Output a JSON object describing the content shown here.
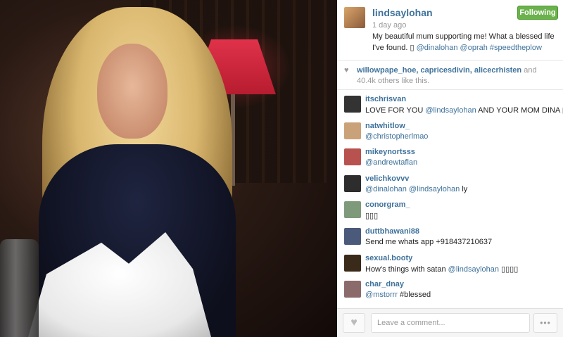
{
  "post": {
    "username": "lindsaylohan",
    "time": "1 day ago",
    "follow_label": "Following",
    "caption_text": "My beautiful mum supporting me! What a blessed life I've found. ",
    "caption_emoji": "▯",
    "caption_mentions": "@dinalohan @oprah",
    "caption_tag": "#speedtheplow"
  },
  "likes": {
    "icon": "heart-icon",
    "users": "willowpape_hoe, capricesdivin, alicecrhisten",
    "count_text": " and 40.4k others like this."
  },
  "comments": [
    {
      "user": "itschrisvan",
      "pre": "LOVE FOR YOU ",
      "mention": "@lindsaylohan",
      "post": " AND YOUR MOM DINA ▯▯▯▯",
      "avatar_color": "#333333"
    },
    {
      "user": "natwhitlow_",
      "pre": "",
      "mention": "@christopherlmao",
      "post": "",
      "avatar_color": "#c9a27a"
    },
    {
      "user": "mikeynortsss",
      "pre": "",
      "mention": "@andrewtaflan",
      "post": "",
      "avatar_color": "#b7524f"
    },
    {
      "user": "velichkovvv",
      "pre": "",
      "mention": "@dinalohan @lindsaylohan",
      "post": " ly",
      "avatar_color": "#2d2d2d"
    },
    {
      "user": "conorgram_",
      "pre": "▯▯▯",
      "mention": "",
      "post": "",
      "avatar_color": "#7f9a7a"
    },
    {
      "user": "duttbhawani88",
      "pre": "Send me whats app +918437210637",
      "mention": "",
      "post": "",
      "avatar_color": "#4b5a7a"
    },
    {
      "user": "sexual.booty",
      "pre": "How's things with satan ",
      "mention": "@lindsaylohan",
      "post": " ▯▯▯▯",
      "avatar_color": "#3a2a1a"
    },
    {
      "user": "char_dnay",
      "pre": "",
      "mention": "@mstorrr",
      "post": " #blessed",
      "avatar_color": "#8a6a6a"
    }
  ],
  "footer": {
    "comment_placeholder": "Leave a comment...",
    "like_icon": "heart-icon",
    "more_icon": "ellipsis-icon",
    "more_label": "•••"
  },
  "colors": {
    "link": "#3f729b",
    "follow_button": "#6bb24d"
  }
}
